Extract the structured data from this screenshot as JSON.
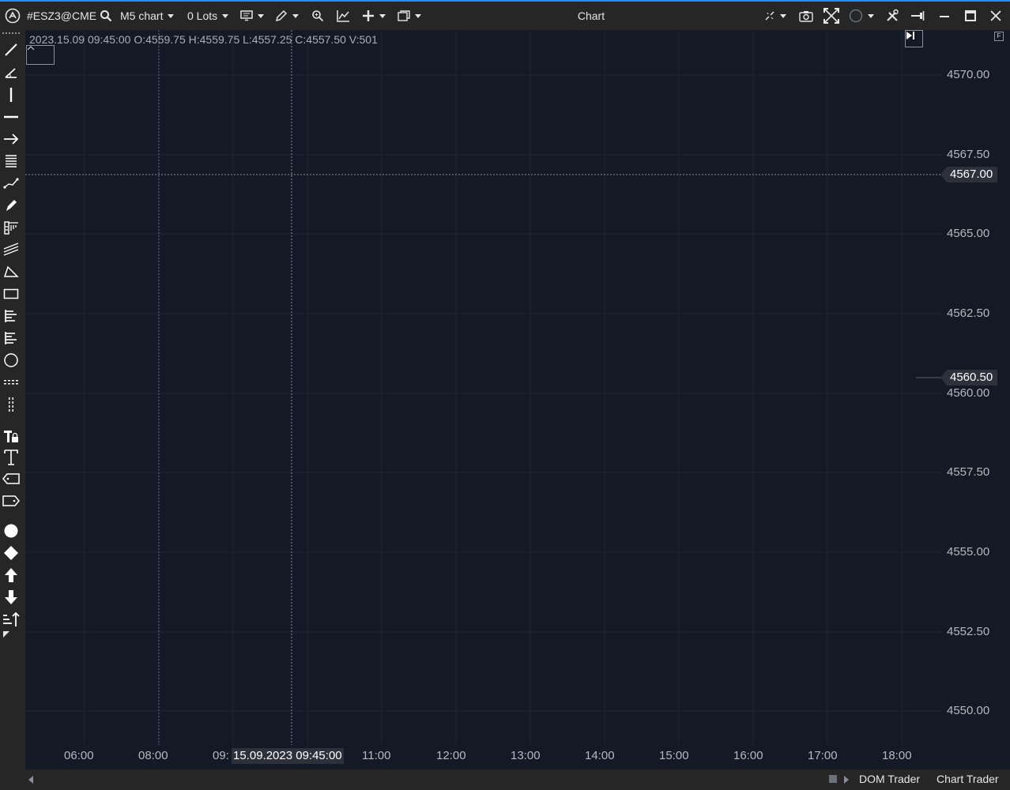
{
  "toolbar": {
    "symbol": "#ESZ3@CME",
    "timeframe": "M5 chart",
    "lots": "0 Lots",
    "window_title": "Chart"
  },
  "chart": {
    "ohlc_info": "2023.15.09 09:45:00 O:4559.75 H:4559.75 L:4557.25 C:4557.50 V:501",
    "y_axis_labels": [
      "4570.00",
      "4567.50",
      "4565.00",
      "4562.50",
      "4560.00",
      "4557.50",
      "4555.00",
      "4552.50",
      "4550.00"
    ],
    "crosshair_price": "4567.00",
    "last_price": "4560.50",
    "x_axis_labels": [
      "06:00",
      "08:00",
      "09:",
      "11:00",
      "12:00",
      "13:00",
      "14:00",
      "15:00",
      "16:00",
      "17:00",
      "18:00"
    ],
    "crosshair_time": "15.09.2023 09:45:00",
    "colors": {
      "background": "#141a25",
      "toolbar": "#262626",
      "grid": "#1e2533",
      "text": "#b4b8c0",
      "accent": "#1e90ff"
    }
  },
  "bottom": {
    "tabs": [
      "DOM Trader",
      "Chart Trader"
    ]
  }
}
